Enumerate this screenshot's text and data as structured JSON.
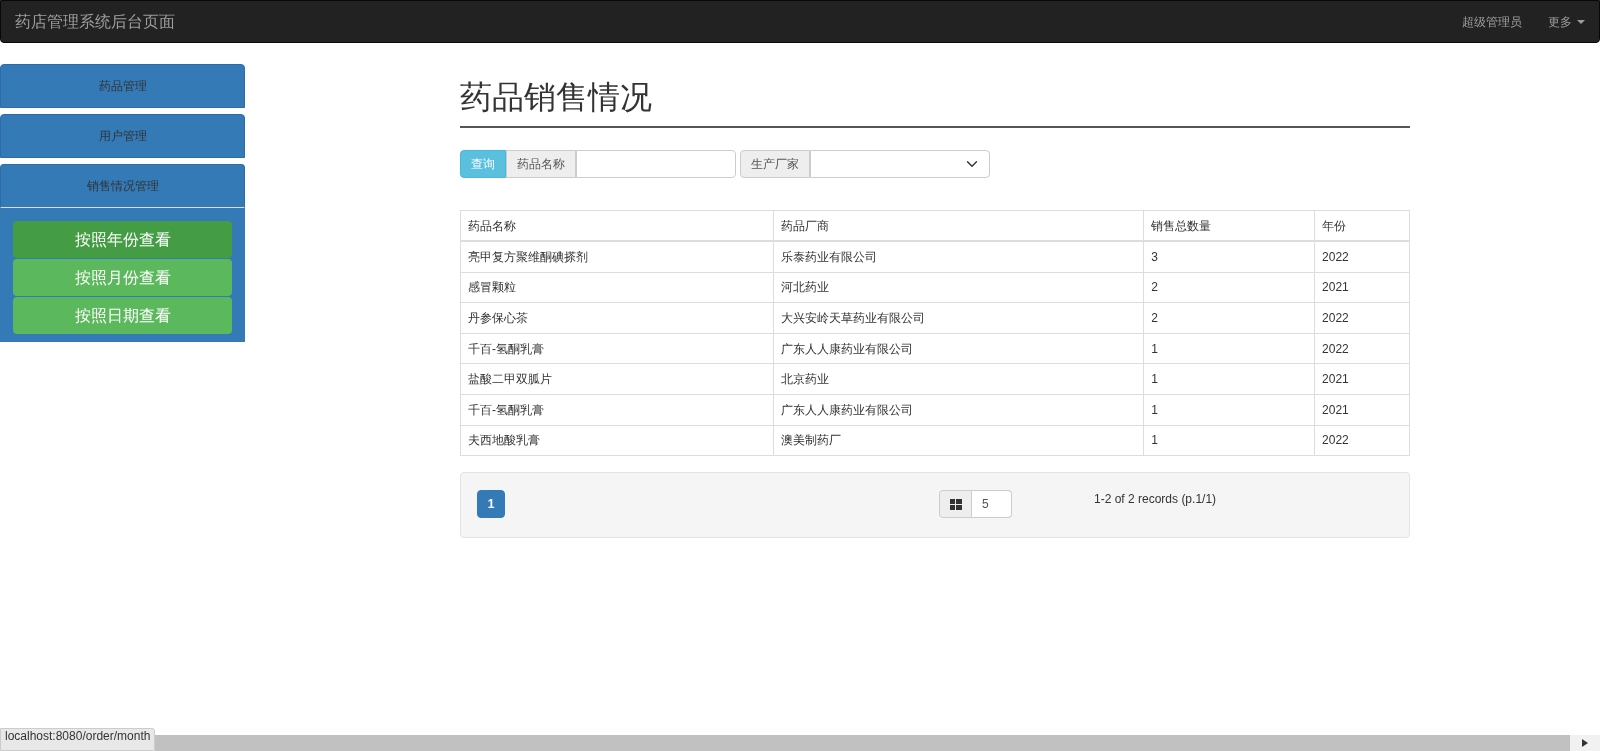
{
  "navbar": {
    "brand": "药店管理系统后台页面",
    "right_items": [
      {
        "label": "超级管理员",
        "dropdown": false
      },
      {
        "label": "更多",
        "dropdown": true
      }
    ]
  },
  "sidebar": {
    "items": [
      {
        "label": "药品管理",
        "expanded": false
      },
      {
        "label": "用户管理",
        "expanded": false
      },
      {
        "label": "销售情况管理",
        "expanded": true,
        "children": [
          {
            "label": "按照年份查看",
            "selected": true
          },
          {
            "label": "按照月份查看",
            "selected": false
          },
          {
            "label": "按照日期查看",
            "selected": false
          }
        ]
      }
    ]
  },
  "page_title": "药品销售情况",
  "search": {
    "button": "查询",
    "fields": [
      {
        "kind": "text",
        "label": "药品名称"
      },
      {
        "kind": "select",
        "label": "生产厂家"
      }
    ]
  },
  "table": {
    "columns": [
      "药品名称",
      "药品厂商",
      "销售总数量",
      "年份"
    ],
    "rows": [
      [
        "亮甲复方聚维酮碘搽剂",
        "乐泰药业有限公司",
        "3",
        "2022"
      ],
      [
        "感冒颗粒",
        "河北药业",
        "2",
        "2021"
      ],
      [
        "丹参保心茶",
        "大兴安岭天草药业有限公司",
        "2",
        "2022"
      ],
      [
        "千百-氢酮乳膏",
        "广东人人康药业有限公司",
        "1",
        "2022"
      ],
      [
        "盐酸二甲双胍片",
        "北京药业",
        "1",
        "2021"
      ],
      [
        "千百-氢酮乳膏",
        "广东人人康药业有限公司",
        "1",
        "2021"
      ],
      [
        "夫西地酸乳膏",
        "澳美制药厂",
        "1",
        "2022"
      ]
    ]
  },
  "pagination": {
    "pages": [
      {
        "label": "1",
        "selected": true
      }
    ],
    "page_size": "5",
    "summary": "1-2 of 2 records (p.1/1)"
  },
  "status_bar": {
    "url": "localhost:8080/order/month"
  }
}
